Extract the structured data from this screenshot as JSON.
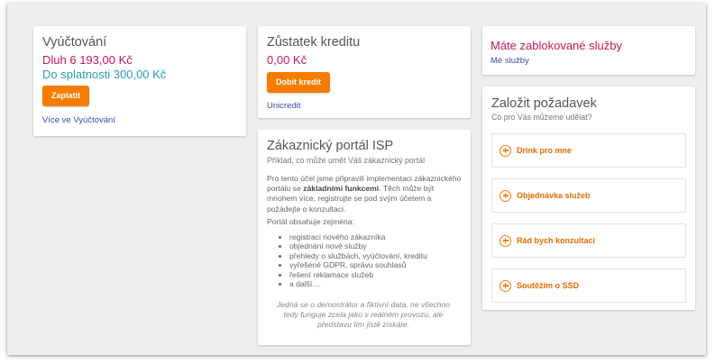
{
  "billing": {
    "title": "Vyúčtování",
    "debt": "Dluh 6 193,00 Kč",
    "due": "Do splatnosti 300,00 Kč",
    "pay_button": "Zaplatit",
    "more_link": "Více ve Vyúčtování"
  },
  "credit": {
    "title": "Zůstatek kreditu",
    "amount": "0,00 Kč",
    "topup_button": "Dobít kredit",
    "link": "Unicredit"
  },
  "blocked": {
    "title": "Máte zablokované služby",
    "link": "Mé služby"
  },
  "portal": {
    "title": "Zákaznický portál ISP",
    "subtitle": "Příklad, co může umět Váš zákaznický portál",
    "p1_before": "Pro tento účel jsme připravili implementaci zákaznického portálu se ",
    "p1_bold": "základními funkcemi",
    "p1_after": ". Těch může být mnohem více, registrujte se pod svým účetem a požádejte o konzultaci.",
    "p2": "Portál obsahuje zejména:",
    "features": [
      "registraci nového zákazníka",
      "objednání nové služby",
      "přehledy o službách, vyúčtování, kreditu",
      "vyřešené GDPR, správu souhlasů",
      "řešení reklamace služeb",
      "a další...."
    ],
    "note": "Jedná se o demostrátor a fiktivní data, ne všechno tedy funguje zcela jako v reálném provozu, ale představu tím jistě získáte."
  },
  "requests": {
    "title": "Založit požadavek",
    "subtitle": "Co pro Vás můžeme udělat?",
    "items": [
      "Drink pro mne",
      "Objednávka služeb",
      "Rád bych konzultaci",
      "Soutěžím o SSD"
    ]
  },
  "colors": {
    "debt": "#c2185b",
    "due": "#2a9db5",
    "blocked": "#c2185b",
    "accent": "#f57c00"
  }
}
